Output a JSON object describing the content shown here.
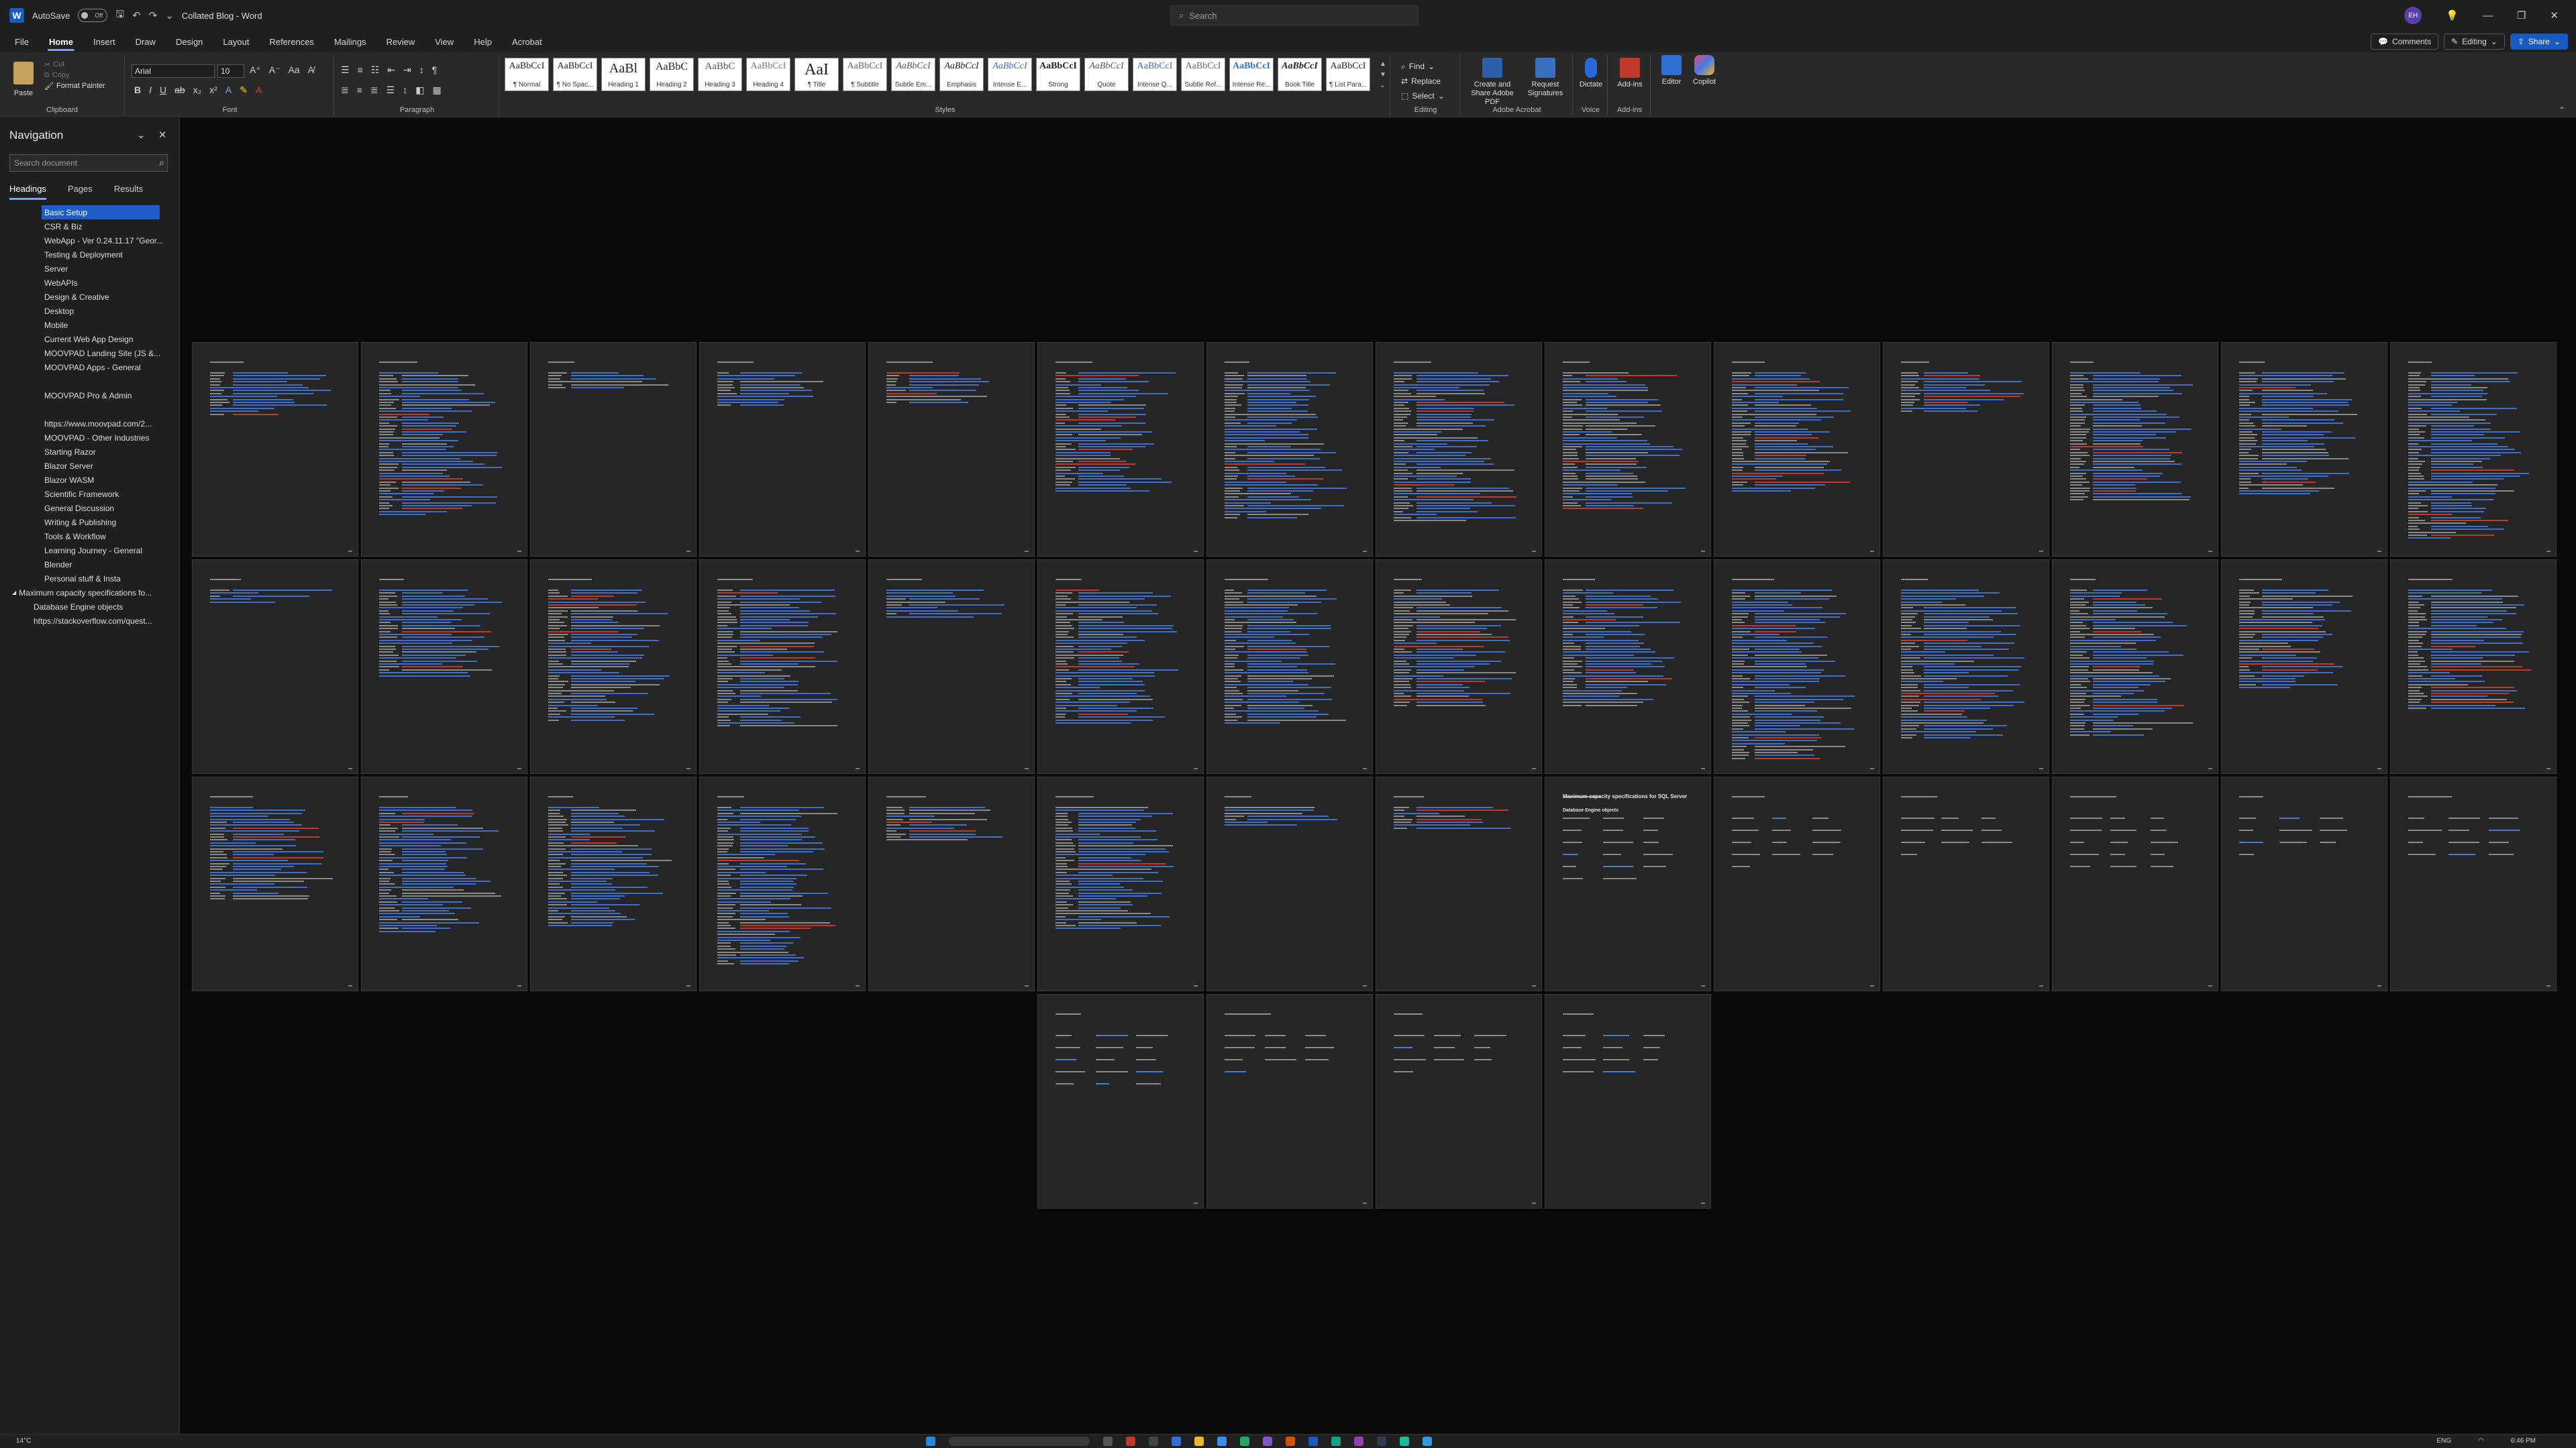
{
  "titlebar": {
    "autosave_label": "AutoSave",
    "autosave_state": "Off",
    "doc_title": "Collated Blog - Word",
    "search_placeholder": "Search",
    "user_initials": "EH"
  },
  "menu": {
    "tabs": [
      "File",
      "Home",
      "Insert",
      "Draw",
      "Design",
      "Layout",
      "References",
      "Mailings",
      "Review",
      "View",
      "Help",
      "Acrobat"
    ],
    "active_tab": "Home",
    "comments_label": "Comments",
    "editing_label": "Editing",
    "share_label": "Share"
  },
  "ribbon": {
    "clipboard": {
      "paste": "Paste",
      "cut": "Cut",
      "copy": "Copy",
      "format_painter": "Format Painter",
      "label": "Clipboard"
    },
    "font": {
      "name": "Arial",
      "size": "10",
      "label": "Font"
    },
    "paragraph": {
      "label": "Paragraph"
    },
    "styles": {
      "label": "Styles",
      "items": [
        {
          "sample": "AaBbCcI",
          "name": "¶ Normal"
        },
        {
          "sample": "AaBbCcI",
          "name": "¶ No Spac..."
        },
        {
          "sample": "AaBl",
          "name": "Heading 1"
        },
        {
          "sample": "AaBbC",
          "name": "Heading 2"
        },
        {
          "sample": "AaBbC",
          "name": "Heading 3"
        },
        {
          "sample": "AaBbCcI",
          "name": "Heading 4"
        },
        {
          "sample": "AaI",
          "name": "¶ Title"
        },
        {
          "sample": "AaBbCcI",
          "name": "¶ Subtitle"
        },
        {
          "sample": "AaBbCcI",
          "name": "Subtle Em..."
        },
        {
          "sample": "AaBbCcI",
          "name": "Emphasis"
        },
        {
          "sample": "AaBbCcI",
          "name": "Intense E..."
        },
        {
          "sample": "AaBbCcI",
          "name": "Strong"
        },
        {
          "sample": "AaBbCcI",
          "name": "Quote"
        },
        {
          "sample": "AaBbCcI",
          "name": "Intense Q..."
        },
        {
          "sample": "AaBbCcI",
          "name": "Subtle Ref..."
        },
        {
          "sample": "AaBbCcI",
          "name": "Intense Re..."
        },
        {
          "sample": "AaBbCcI",
          "name": "Book Title"
        },
        {
          "sample": "AaBbCcI",
          "name": "¶ List Para..."
        }
      ]
    },
    "editing": {
      "find": "Find",
      "replace": "Replace",
      "select": "Select",
      "label": "Editing"
    },
    "acrobat": {
      "create": "Create and Share Adobe PDF",
      "request": "Request Signatures",
      "label": "Adobe Acrobat"
    },
    "voice": {
      "dictate": "Dictate",
      "label": "Voice"
    },
    "addins": {
      "addins": "Add-ins",
      "label": "Add-ins"
    },
    "editor": "Editor",
    "copilot": "Copilot"
  },
  "nav": {
    "title": "Navigation",
    "search_placeholder": "Search document",
    "tabs": [
      "Headings",
      "Pages",
      "Results"
    ],
    "active_tab": "Headings",
    "items": [
      {
        "label": "Basic Setup",
        "level": 1,
        "selected": true
      },
      {
        "label": "CSR & Biz",
        "level": 1
      },
      {
        "label": "WebApp - Ver 0.24.11.17 \"Geor...",
        "level": 1
      },
      {
        "label": "Testing & Deployment",
        "level": 1
      },
      {
        "label": "Server",
        "level": 1
      },
      {
        "label": "WebAPIs",
        "level": 1
      },
      {
        "label": "Design & Creative",
        "level": 1
      },
      {
        "label": "Desktop",
        "level": 1
      },
      {
        "label": "Mobile",
        "level": 1
      },
      {
        "label": "Current Web App Design",
        "level": 1
      },
      {
        "label": "MOOVPAD Landing Site (JS &...",
        "level": 1
      },
      {
        "label": "MOOVPAD Apps - General",
        "level": 1
      },
      {
        "label": "",
        "level": 1
      },
      {
        "label": "MOOVPAD Pro & Admin",
        "level": 1
      },
      {
        "label": "",
        "level": 1
      },
      {
        "label": "https://www.moovpad.com/2...",
        "level": 1
      },
      {
        "label": "MOOVPAD - Other Industries",
        "level": 1
      },
      {
        "label": "Starting Razor",
        "level": 1
      },
      {
        "label": "Blazor Server",
        "level": 1
      },
      {
        "label": "Blazor WASM",
        "level": 1
      },
      {
        "label": "Scientific Framework",
        "level": 1
      },
      {
        "label": "General Discussion",
        "level": 1
      },
      {
        "label": "Writing & Publishing",
        "level": 1
      },
      {
        "label": "Tools & Workflow",
        "level": 1
      },
      {
        "label": "Learning Journey - General",
        "level": 1
      },
      {
        "label": "Blender",
        "level": 1
      },
      {
        "label": "Personal stuff & Insta",
        "level": 1
      },
      {
        "label": "Maximum capacity specifications fo...",
        "level": 0,
        "expand": true
      },
      {
        "label": "Database Engine objects",
        "level": 2
      },
      {
        "label": "https://stackoverflow.com/quest...",
        "level": 2
      }
    ]
  },
  "document": {
    "page_heading": "Maximum capacity specifications for SQL Server",
    "page_subheading": "Database Engine objects"
  },
  "taskbar": {
    "weather": "14°C",
    "language": "ENG",
    "time": "6:46 PM"
  }
}
